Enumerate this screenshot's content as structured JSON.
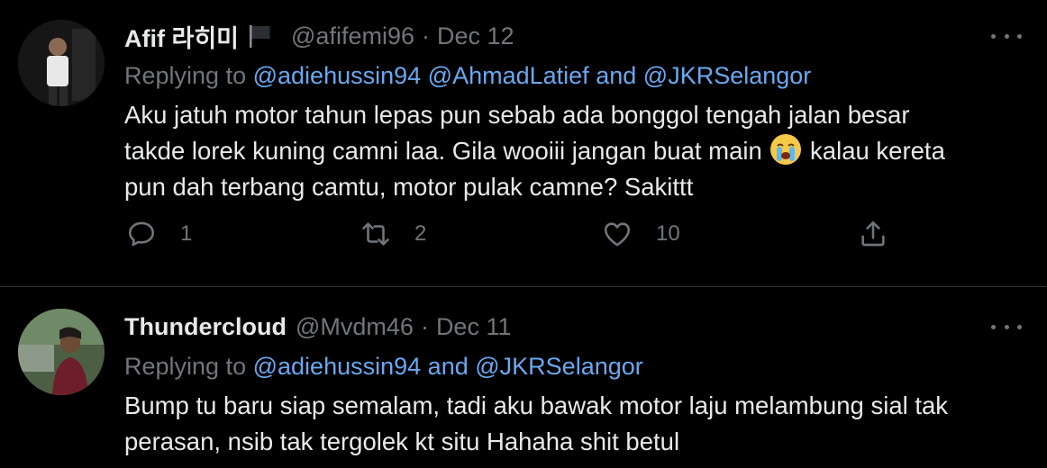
{
  "tweets": [
    {
      "name": "Afif 라히미",
      "handle": "@afifemi96",
      "separator": "·",
      "date": "Dec 12",
      "replying_prefix": "Replying to",
      "mention_1": "@adiehussin94",
      "mention_2": "@AhmadLatief",
      "mention_connector": "and",
      "mention_3": "@JKRSelangor",
      "text_part1": "Aku jatuh motor tahun lepas pun sebab ada bonggol tengah jalan besar\ntakde lorek kuning camni laa. Gila wooiii jangan buat main ",
      "text_part2": " kalau kereta\npun dah terbang camtu, motor pulak camne? Sakittt",
      "emoji": "loudly-crying-face-icon",
      "flag_icon": "black-flag-icon",
      "replies": "1",
      "retweets": "2",
      "likes": "10"
    },
    {
      "name": "Thundercloud",
      "handle": "@Mvdm46",
      "separator": "·",
      "date": "Dec 11",
      "replying_prefix": "Replying to",
      "mention_1": "@adiehussin94",
      "mention_connector": "and",
      "mention_2": "@JKRSelangor",
      "text": "Bump tu baru siap semalam, tadi aku bawak motor laju melambung sial tak\nperasan, nsib tak tergolek kt situ Hahaha shit betul"
    }
  ],
  "colors": {
    "background": "#000000",
    "text_primary": "#e7e9ea",
    "text_secondary": "#71767b",
    "link": "#6aa8f0",
    "divider": "#2f3336"
  }
}
